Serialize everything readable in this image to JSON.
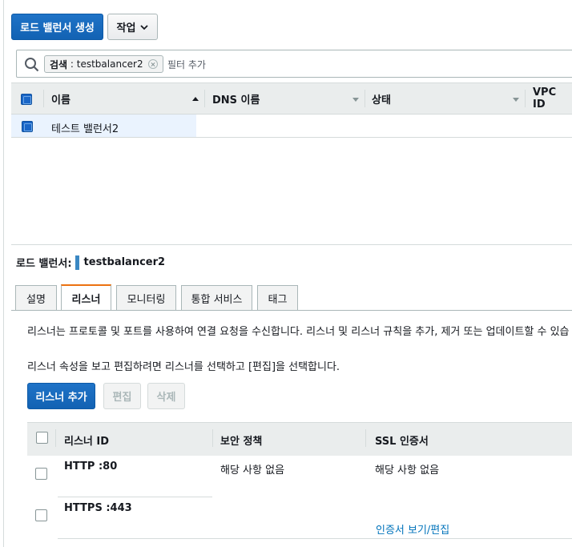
{
  "toolbar": {
    "create_lb_label": "로드 밸런서 생성",
    "actions_label": "작업"
  },
  "search": {
    "token_key": "검색",
    "token_sep": " : ",
    "token_value": "testbalancer2",
    "placeholder": "필터 추가"
  },
  "lb_table": {
    "columns": [
      "이름",
      "DNS 이름",
      "상태",
      "VPC ID"
    ],
    "rows": [
      {
        "name": "테스트 밸런서2"
      }
    ]
  },
  "details": {
    "title_label": "로드 밸런서:",
    "title_value": "testbalancer2",
    "tabs": [
      "설명",
      "리스너",
      "모니터링",
      "통합 서비스",
      "태그"
    ],
    "active_tab": "리스너",
    "description": "리스너는 프로토콜 및 포트를 사용하여 연결 요청을 수신합니다. 리스너 및 리스너 규칙을 추가, 제거 또는 업데이트할 수 있습",
    "instruction": "리스너 속성을 보고 편집하려면 리스너를 선택하고 [편집]을 선택합니다.",
    "buttons": {
      "add": "리스너 추가",
      "edit": "편집",
      "delete": "삭제"
    }
  },
  "listener_table": {
    "columns": [
      "리스너 ID",
      "보안 정책",
      "SSL 인증서"
    ],
    "rows": [
      {
        "id": "HTTP :80",
        "policy": "해당 사항 없음",
        "ssl": "해당 사항 없음",
        "ssl_link": ""
      },
      {
        "id": "HTTPS :443",
        "policy": "",
        "ssl": "",
        "ssl_link": "인증서 보기/편집"
      }
    ]
  },
  "colors": {
    "primary": "#1262b3",
    "tab_accent": "#ec7211",
    "link": "#0073bb",
    "header_bg": "#eaeded"
  }
}
